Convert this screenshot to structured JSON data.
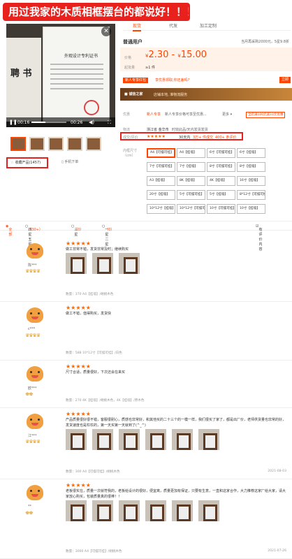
{
  "banner": "用过我家的木质相框摆台的都说好！！！",
  "video": {
    "cert_title": "外观设计专利证书",
    "cert_side_text": "聘 书",
    "current_time": "00:16",
    "duration": "00:26",
    "progress": 0.4
  },
  "left": {
    "fav_icon": "☆",
    "fav_label": "收藏产品(1457)",
    "scan_label": "手机下单"
  },
  "tabs": [
    "现货",
    "代发",
    "加工定制"
  ],
  "header": {
    "store": "普通用户",
    "return_policy": "当月再采购2000元，5星9.8折"
  },
  "price": {
    "label": "价格",
    "currency": "¥",
    "min": "2.30",
    "sep": " - ",
    "max": "15.00",
    "moq_label": "起批量",
    "moq": "≥1 件"
  },
  "promo": {
    "tag": "新人专享红包",
    "text": "享优惠领取,你还差吗?",
    "btn": "立即"
  },
  "shop": {
    "logo": "■ 诚信之家",
    "text": "店铺本地, 准物流服务"
  },
  "rows": {
    "benefit_label": "优惠",
    "benefit_a": "新人专享",
    "benefit_b": "新人专享价格可享至优惠...",
    "benefit_c": "更多 ▾",
    "coupon": "全店满100元减10元优惠",
    "ship_label": "物流",
    "ship_from": "浙江省 金华市",
    "ship_to": "时效此品/天内发货发货",
    "rating_label": "成交/评价",
    "rating_stars": "★★★★★",
    "rating_value": "30天内",
    "sold": "3万+ 件成交",
    "reviews": "400+ 条评价",
    "size_label": "内框尺寸（cm）"
  },
  "sizes": [
    "A4【可摆可挂】",
    "A4【挂墙】",
    "6寸【可摆可挂】",
    "6寸【挂墙】",
    "7寸【可摆可挂】",
    "7寸【挂墙】",
    "8寸【可摆可挂】",
    "8寸【挂墙】",
    "A3【挂墙】",
    "8K【挂墙】",
    "4K【挂墙】",
    "16寸【挂墙】",
    "20寸【挂墙】",
    "5寸【可摆可挂】",
    "5寸【挂墙】",
    "8*12寸【可摆可挂】",
    "10*12寸【挂墙】",
    "10*12寸【可摆可挂】",
    "10寸【可摆可挂】",
    "10寸【挂墙】"
  ],
  "filter": {
    "all": "全部",
    "four_five": "四星五星",
    "four_five_count": "（30+）",
    "three": "三星",
    "three_count": "（0）",
    "one_two": "一星二星",
    "one_two_count": "（0）",
    "with_content": "有评价内容"
  },
  "reviews": [
    {
      "user": "陈***",
      "badge": "♛♛♛♛",
      "stars": "★★★★★",
      "text": "做工非常不错，发货非常及时；继续购买",
      "meta": "数量：370   A4【挂墙】/胡桃木色",
      "date": ""
    },
    {
      "user": "c***",
      "badge": "♛♛♛♛",
      "stars": "★★★★★",
      "text": "做工不错，值得购买，发货快",
      "meta": "数量：588   10*12寸【可摆可挂】/白色",
      "date": ""
    },
    {
      "user": "欧***",
      "badge": "♚♚",
      "stars": "★★★★★",
      "text": "尺寸合适，质量很好，下次还会在来买",
      "meta": "数量：270   4K【挂墙】/胡桃木色，4K【挂墙】/原木色",
      "date": ""
    },
    {
      "user": "江***",
      "badge": "♛♛♛♛",
      "stars": "★★★★★",
      "text": "产品质量很好很不错，客服很耐心，质感也非常好，和其他买的二十三个的一模一样，我们很买了家了，都是出厂价，老师供货量也非常的好，发货速度也是杠杠的，第一天买第一天就到了(^_^)",
      "meta": "数量：300   A4【可摆可挂】/胡桃木色",
      "date": "2021-08-03"
    },
    {
      "user": "**",
      "badge": "♚♚",
      "stars": "★★★★★",
      "text": "老板很实在，质量一次就符我的，老板给设计的很好，便宜离，质量更加有保证，只要有生意，一直和这家合作，大力推荐这家厂给大家，请大家放心购买，包装质量真的很棒！！",
      "meta": "数量：3000   A4【可摆可挂】/胡桃木色",
      "date": "2021-07-26"
    }
  ]
}
